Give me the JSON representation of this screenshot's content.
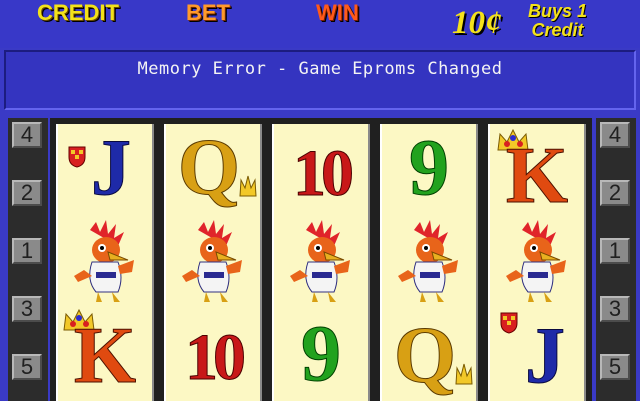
{
  "meters": {
    "credit_label": "CREDIT",
    "bet_label": "BET",
    "win_label": "WIN",
    "denomination": "10¢",
    "buys_line1": "Buys 1",
    "buys_line2": "Credit"
  },
  "message": "Memory Error - Game Eproms Changed",
  "line_indicators": {
    "left": [
      "4",
      "2",
      "1",
      "3",
      "5"
    ],
    "right": [
      "4",
      "2",
      "1",
      "3",
      "5"
    ]
  },
  "reels": [
    [
      "J",
      "bird",
      "K"
    ],
    [
      "Q",
      "bird",
      "10"
    ],
    [
      "10",
      "bird",
      "9"
    ],
    [
      "9",
      "bird",
      "Q"
    ],
    [
      "K",
      "bird",
      "J"
    ]
  ],
  "colors": {
    "background": "#3a3ac6",
    "credit": "#f2e21a",
    "bet": "#ff9a2a",
    "win": "#ff5a1a",
    "reel_strip": "#fcf8c4"
  },
  "icons": {
    "bird": "cockatoo-bird-icon",
    "shield": "heraldic-shield-icon",
    "crown": "crown-icon"
  }
}
